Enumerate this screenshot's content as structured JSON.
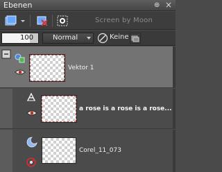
{
  "titlebar": {
    "title": "Ebenen",
    "pin": "⊕",
    "close": "×"
  },
  "toolbar": {
    "watermark": "Screen by Moon"
  },
  "options": {
    "opacity": "100",
    "blend_mode": "Normal",
    "lock_label": "Keine"
  },
  "layers": [
    {
      "name": "Vektor 1",
      "type": "vector-group",
      "visible": true,
      "selected": true
    },
    {
      "name": "a rose is a rose is a rose...",
      "type": "text",
      "visible": true,
      "selected": false
    },
    {
      "name": "Corel_11_073",
      "type": "raster",
      "visible": false,
      "selected": false
    }
  ],
  "colors": {
    "panel_bg": "#4a4a4a",
    "selected_row": "#737373",
    "thumb_border": "#c04a4a"
  }
}
